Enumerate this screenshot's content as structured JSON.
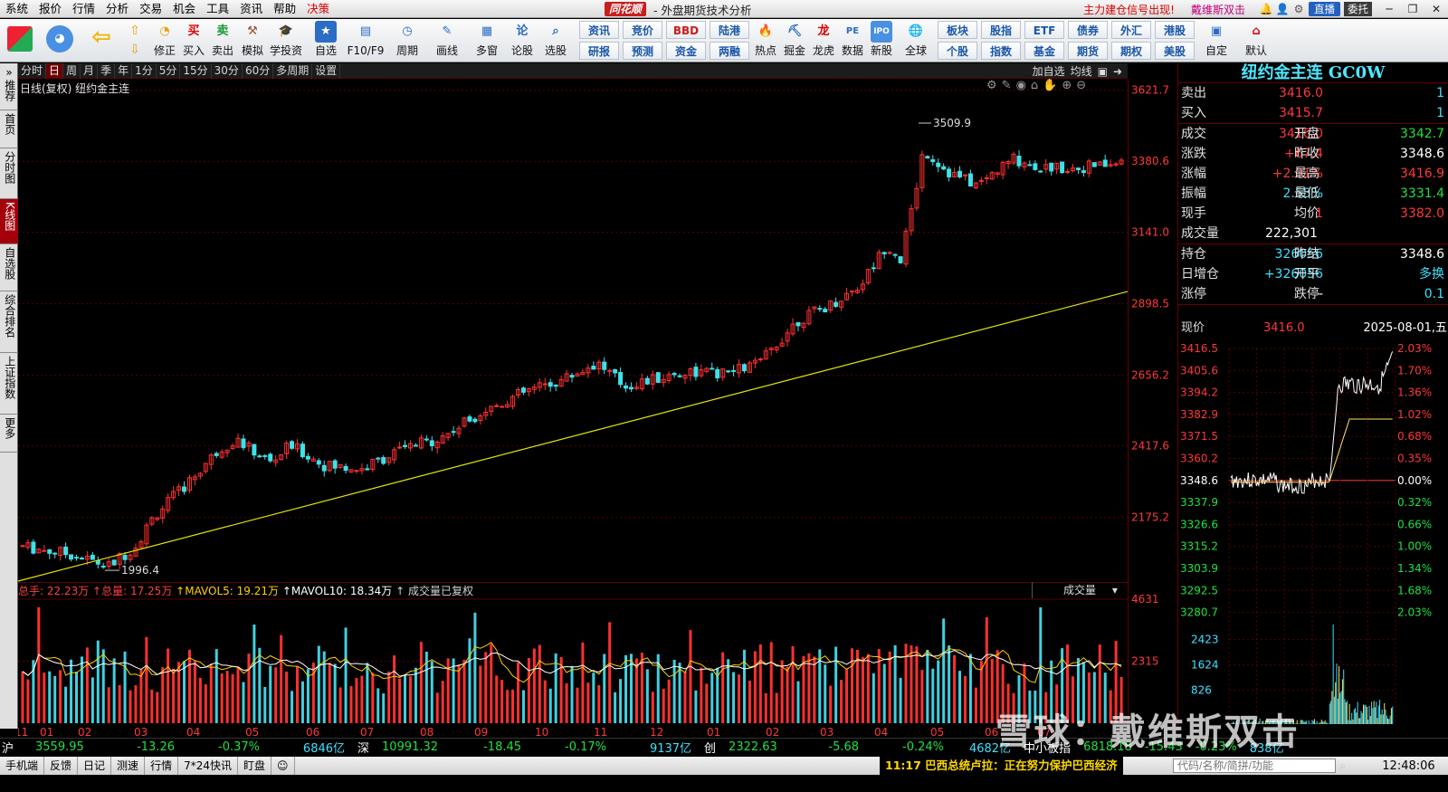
{
  "menubar": {
    "items": [
      "系统",
      "报价",
      "行情",
      "分析",
      "交易",
      "机会",
      "工具",
      "资讯",
      "帮助",
      "决策"
    ],
    "logo": "同花顺",
    "subtitle": "- 外盘期货技术分析",
    "notice": "主力建仓信号出现!",
    "user": "戴维斯双击",
    "live_label": "直播",
    "trust_label": "委托"
  },
  "toolbar": {
    "buttons": [
      "修正",
      "买入",
      "卖出",
      "模拟",
      "学投资",
      "自选",
      "F10/F9",
      "周期",
      "画线",
      "多窗",
      "论股",
      "选股"
    ],
    "grid1": [
      [
        "资讯",
        "研报"
      ],
      [
        "竞价",
        "预测"
      ],
      [
        "BBD",
        "资金"
      ],
      [
        "陆港",
        "两融"
      ]
    ],
    "buttons2": [
      "热点",
      "掘金",
      "龙虎",
      "数据",
      "新股",
      "全球"
    ],
    "grid2": [
      [
        "板块",
        "个股"
      ],
      [
        "股指",
        "指数"
      ],
      [
        "ETF",
        "基金"
      ],
      [
        "债券",
        "期货"
      ],
      [
        "外汇",
        "期权"
      ],
      [
        "港股",
        "美股"
      ]
    ],
    "buttons3": [
      "自定",
      "默认"
    ]
  },
  "leftbar": [
    "推荐",
    "首页",
    "分时图",
    "K线图",
    "自选股",
    "综合排名",
    "上证指数",
    "更多"
  ],
  "periods": [
    "分时",
    "日",
    "周",
    "月",
    "季",
    "年",
    "1分",
    "5分",
    "15分",
    "30分",
    "60分",
    "多周期",
    "设置"
  ],
  "period_right": [
    "加自选",
    "均线"
  ],
  "chart": {
    "info": "日线(复权)  纽约金主连",
    "price_ticks": [
      "3621.7",
      "3380.6",
      "3141.0",
      "2898.5",
      "2656.2",
      "2417.6",
      "2175.2"
    ],
    "annot_high": "3509.9",
    "annot_low": "1996.4",
    "months": [
      "11",
      "01",
      "02",
      "03",
      "04",
      "05",
      "06",
      "07",
      "08",
      "09",
      "10",
      "11",
      "12",
      "01",
      "02",
      "03",
      "04",
      "05",
      "06",
      "07"
    ]
  },
  "chart_data": {
    "type": "candlestick",
    "ylim": [
      1960,
      3660
    ],
    "high": 3509.9,
    "low": 1996.4,
    "volume_ticks": [
      "4631",
      "2315"
    ]
  },
  "volume": {
    "zongshou": "总手: 22.23万",
    "zongliang": "↑总量: 17.25万",
    "mavol5": "↑MAVOL5: 19.21万",
    "mavol10": "↑MAVOL10: 18.34万",
    "note": "↑ 成交量已复权",
    "tag": "成交量"
  },
  "quote": {
    "title": "纽约金主连 GC0W",
    "sell_label": "卖出",
    "sell_price": "3416.0",
    "sell_vol": "1",
    "buy_label": "买入",
    "buy_price": "3415.7",
    "buy_vol": "1",
    "rows": [
      {
        "l1": "成交",
        "v1": "3416.0",
        "l2": "开盘",
        "v2": "3342.7"
      },
      {
        "l1": "涨跌",
        "v1": "+67.4",
        "l2": "昨收",
        "v2": "3348.6"
      },
      {
        "l1": "涨幅",
        "v1": "+2.01%",
        "l2": "最高",
        "v2": "3416.9"
      },
      {
        "l1": "振幅",
        "v1": "2.55%",
        "l2": "最低",
        "v2": "3331.4"
      },
      {
        "l1": "现手",
        "v1": "1",
        "l2": "均价",
        "v2": "3382.0"
      }
    ],
    "vol_label": "成交量",
    "vol_value": "222,301",
    "rows2": [
      {
        "l1": "持仓",
        "v1": "326056",
        "l2": "昨结",
        "v2": "3348.6"
      },
      {
        "l1": "日增仓",
        "v1": "+326056",
        "l2": "开平",
        "v2": "多换"
      },
      {
        "l1": "涨停",
        "v1": "-",
        "l2": "跌停",
        "v2": "0.1"
      }
    ],
    "now_label": "现价",
    "now_price": "3416.0",
    "now_date": "2025-08-01,五",
    "mini_left": [
      "3416.5",
      "3405.6",
      "3394.2",
      "3382.9",
      "3371.5",
      "3360.2",
      "3348.6",
      "3337.9",
      "3326.6",
      "3315.2",
      "3303.9",
      "3292.5",
      "3280.7"
    ],
    "mini_right": [
      "2.03%",
      "1.70%",
      "1.36%",
      "1.02%",
      "0.68%",
      "0.35%",
      "0.00%",
      "0.32%",
      "0.66%",
      "1.00%",
      "1.34%",
      "1.68%",
      "2.03%"
    ],
    "mini_vol": [
      "2423",
      "1624",
      "826"
    ]
  },
  "status": {
    "sh": "沪",
    "sh_val": "3559.95",
    "sh_chg": "-13.26",
    "sh_pct": "-0.37%",
    "sh_amt": "6846亿",
    "sz": "深",
    "sz_val": "10991.32",
    "sz_chg": "-18.45",
    "sz_pct": "-0.17%",
    "sz_amt": "9137亿",
    "cy": "创",
    "cy_val": "2322.63",
    "cy_chg": "-5.68",
    "cy_pct": "-0.24%",
    "cy_amt": "4682亿",
    "zx": "中小板指",
    "zx_val": "6818.18",
    "zx_chg": "-15.43",
    "zx_pct": "-0.23%",
    "zx_amt": "838亿"
  },
  "bottom": {
    "items": [
      "手机端",
      "反馈",
      "日记",
      "测速",
      "行情",
      "7*24快讯",
      "盯盘"
    ],
    "news": "11:17 巴西总统卢拉：正在努力保护巴西经济",
    "input_placeholder": "代码/名称/简拼/功能",
    "time": "12:48:06"
  },
  "watermark": "雪球：戴维斯双击"
}
